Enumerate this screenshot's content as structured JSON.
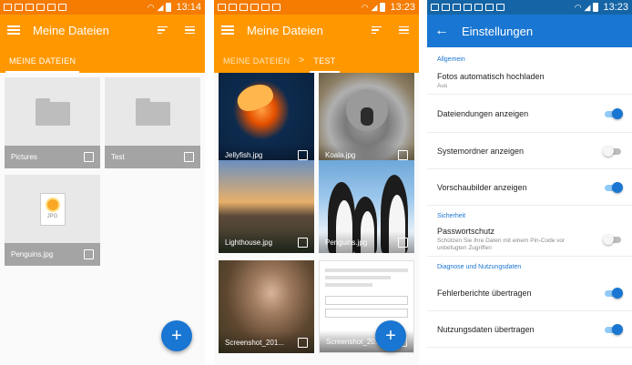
{
  "statusbar": {
    "time1": "13:14",
    "time2": "13:23",
    "time3": "13:23"
  },
  "screen1": {
    "title": "Meine Dateien",
    "tab": "MEINE DATEIEN",
    "items": [
      {
        "name": "Pictures",
        "type": "folder"
      },
      {
        "name": "Test",
        "type": "folder"
      },
      {
        "name": "Penguins.jpg",
        "type": "image"
      }
    ],
    "jpg_label": "JPG",
    "fab": "+"
  },
  "screen2": {
    "title": "Meine Dateien",
    "breadcrumb": [
      "MEINE DATEIEN",
      "TEST"
    ],
    "breadcrumb_sep": ">",
    "photos": [
      "Jellyfish.jpg",
      "Koala.jpg",
      "Lighthouse.jpg",
      "Penguins.jpg",
      "Screenshot_201...",
      "Screenshot_20..."
    ],
    "fab": "+"
  },
  "screen3": {
    "title": "Einstellungen",
    "sections": {
      "general": "Allgemein",
      "security": "Sicherheit",
      "diagnostics": "Diagnose und Nutzungsdaten"
    },
    "rows": {
      "auto_upload": {
        "title": "Fotos automatisch hochladen",
        "sub": "Aus"
      },
      "extensions": {
        "title": "Dateiendungen anzeigen",
        "on": true
      },
      "system_folders": {
        "title": "Systemordner anzeigen",
        "on": false
      },
      "previews": {
        "title": "Vorschaubilder anzeigen",
        "on": true
      },
      "password": {
        "title": "Passwortschutz",
        "sub": "Schützen Sie Ihre Daten mit einem Pin-Code vor unbefugten Zugriffen",
        "on": false
      },
      "errors": {
        "title": "Fehlerberichte übertragen",
        "on": true
      },
      "usage": {
        "title": "Nutzungsdaten übertragen",
        "on": true
      }
    }
  },
  "colors": {
    "orange": "#ff9800",
    "orange_dark": "#f57c00",
    "blue": "#1976d2",
    "blue_dark": "#1565a6"
  },
  "icons": [
    "menu-icon",
    "sort-icon",
    "list-view-icon",
    "back-arrow-icon",
    "folder-icon",
    "checkbox-icon",
    "add-icon"
  ]
}
